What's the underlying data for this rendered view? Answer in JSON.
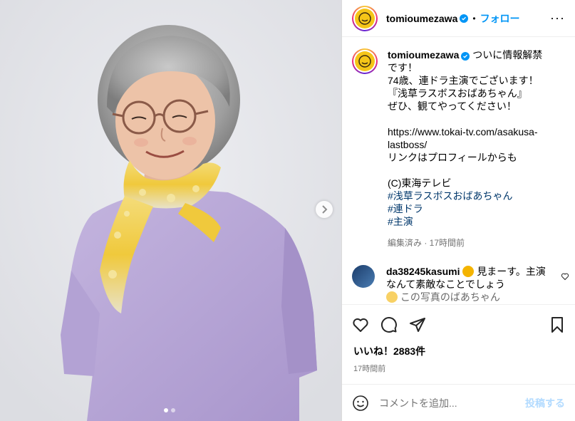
{
  "header": {
    "username": "tomioumezawa",
    "separator": "•",
    "follow_label": "フォロー",
    "more_label": "···"
  },
  "caption": {
    "username": "tomioumezawa",
    "text": "ついに情報解禁です！\n74歳、連ドラ主演でございます！\n『浅草ラスボスおばあちゃん』\nぜひ、観てやってください！\n\nhttps://www.tokai-tv.com/asakusa-lastboss/\nリンクはプロフィールからも\n\n(C)東海テレビ\n",
    "hashtags": [
      "#浅草ラスボスおばあちゃん",
      "#連ドラ",
      "#主演"
    ],
    "meta": "編集済み · 17時間前"
  },
  "comment": {
    "username": "da38245kasumi",
    "text": "見まーす。主演なんて素敵なことでしょう",
    "text_next": "この写真のばあちゃん"
  },
  "likes": "いいね！2883件",
  "time_ago": "17時間前",
  "add_comment": {
    "placeholder": "コメントを追加...",
    "post_label": "投稿する"
  },
  "carousel": {
    "total": 2,
    "current": 1
  },
  "colors": {
    "accent": "#0095f6",
    "post_disabled": "#b3dbff",
    "scarf": "#f2d04a",
    "shirt": "#b9a9d6"
  }
}
